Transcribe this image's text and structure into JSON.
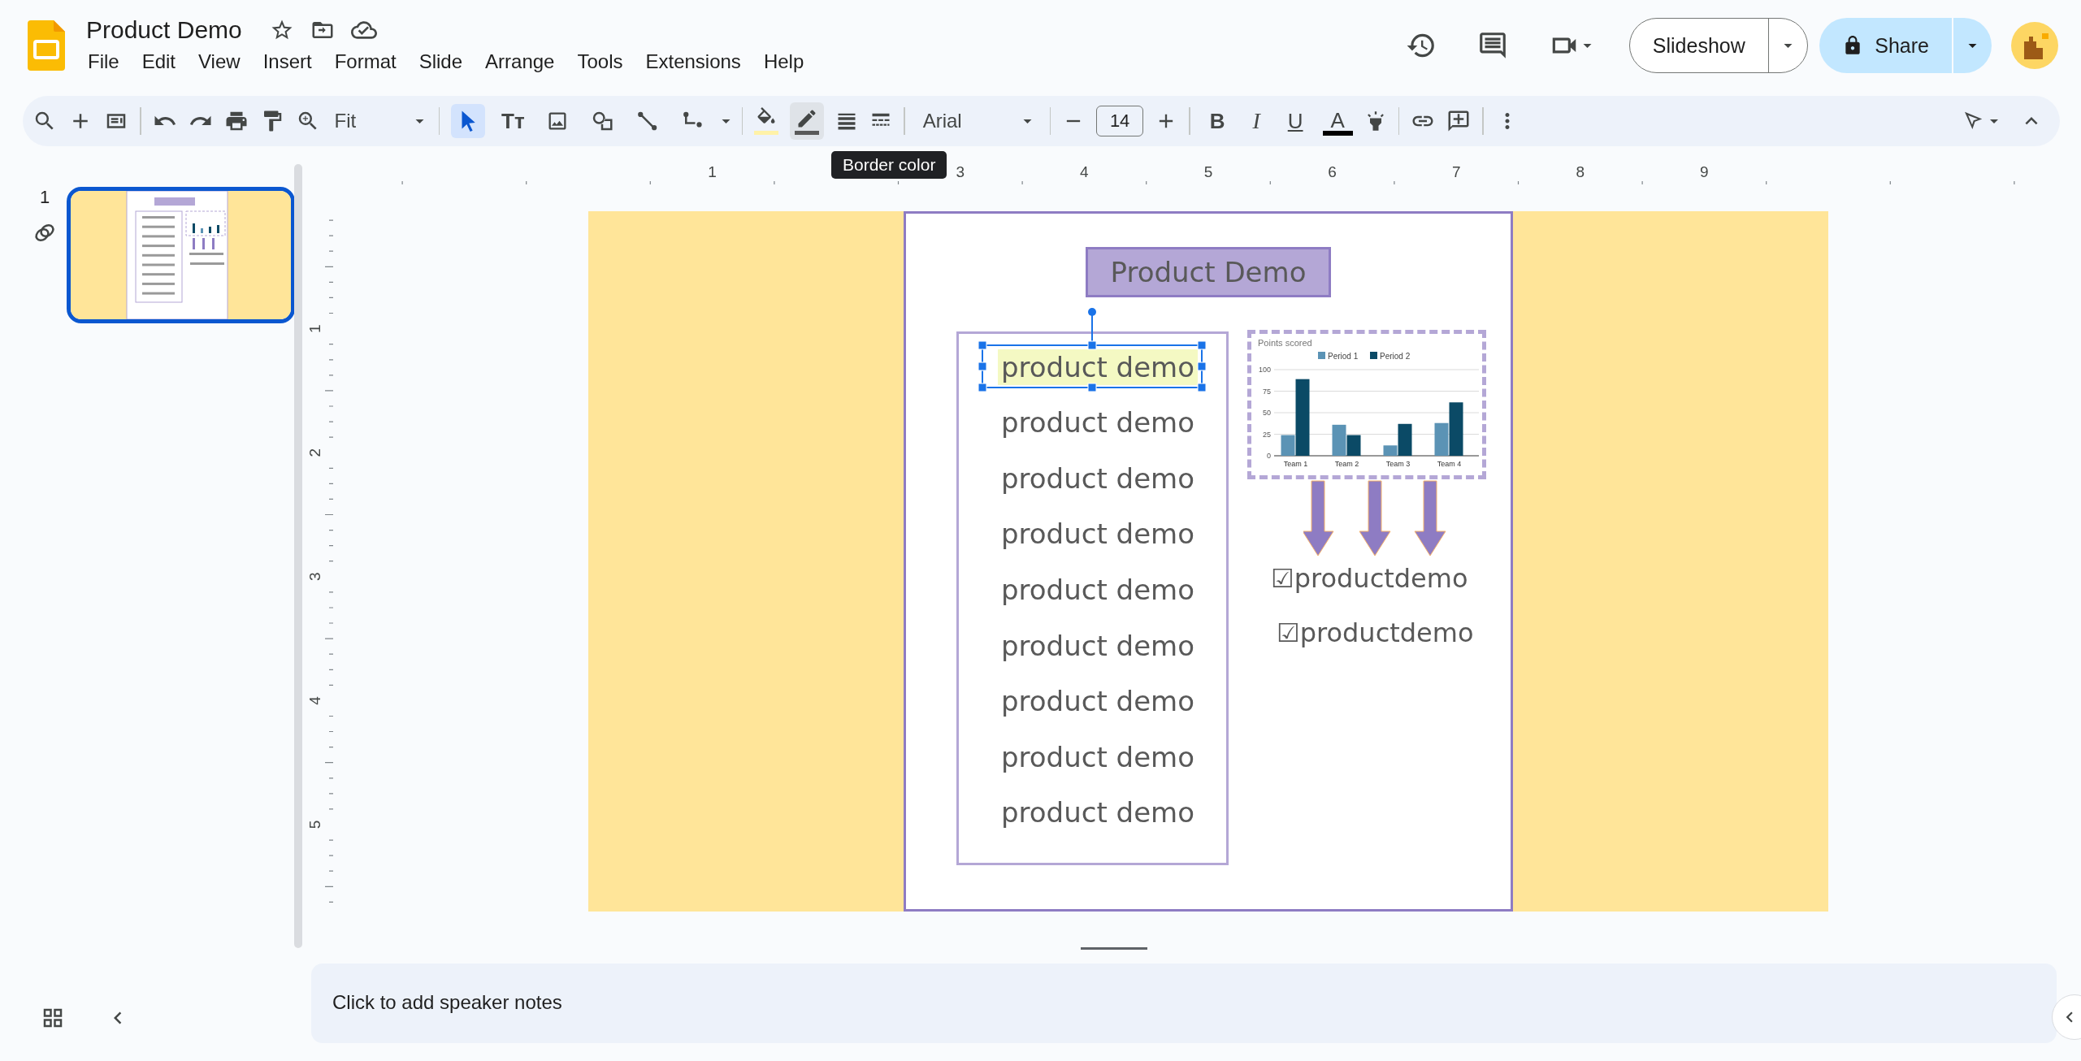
{
  "header": {
    "title": "Product Demo",
    "menu": [
      "File",
      "Edit",
      "View",
      "Insert",
      "Format",
      "Slide",
      "Arrange",
      "Tools",
      "Extensions",
      "Help"
    ],
    "slideshow": "Slideshow",
    "share": "Share"
  },
  "toolbar": {
    "zoom": "Fit",
    "insert_tools": [
      {
        "kind": "select",
        "selected": true
      },
      {
        "kind": "text",
        "label": "Tт",
        "selected": false
      },
      {
        "kind": "image",
        "selected": false
      },
      {
        "kind": "shape",
        "selected": false
      },
      {
        "kind": "line",
        "selected": false
      },
      {
        "kind": "connector",
        "selected": false
      }
    ],
    "border_color": {
      "hovered": true,
      "tooltip": "Border color"
    },
    "font": "Arial",
    "font_size": "14",
    "text_format": [
      {
        "kind": "bold",
        "label": "B"
      },
      {
        "kind": "italic",
        "label": "I"
      },
      {
        "kind": "underline",
        "label": "U"
      },
      {
        "kind": "color",
        "label": "A"
      }
    ]
  },
  "filmstrip": {
    "slides": [
      {
        "number": "1",
        "selected": true
      }
    ]
  },
  "ruler": {
    "horizontal": [
      "1",
      "3",
      "4",
      "5",
      "6",
      "7",
      "8",
      "9"
    ],
    "vertical": [
      "1",
      "2",
      "3",
      "4",
      "5"
    ]
  },
  "slide": {
    "title": "Product Demo",
    "list": [
      {
        "text": "product demo",
        "selected": true
      },
      {
        "text": "product demo",
        "selected": false
      },
      {
        "text": "product demo",
        "selected": false
      },
      {
        "text": "product demo",
        "selected": false
      },
      {
        "text": "product demo",
        "selected": false
      },
      {
        "text": "product demo",
        "selected": false
      },
      {
        "text": "product demo",
        "selected": false
      },
      {
        "text": "product demo",
        "selected": false
      },
      {
        "text": "product demo",
        "selected": false
      }
    ],
    "chart_data": {
      "type": "bar",
      "title": "Points scored",
      "categories": [
        "Team 1",
        "Team 2",
        "Team 3",
        "Team 4"
      ],
      "series": [
        {
          "name": "Period 1",
          "color": "#5b93b5",
          "values": [
            24,
            36,
            12,
            38
          ]
        },
        {
          "name": "Period 2",
          "color": "#0b4a66",
          "values": [
            89,
            24,
            37,
            62
          ]
        }
      ],
      "grid": true,
      "legend": true,
      "ylim": [
        0,
        100
      ],
      "yticks": [
        0,
        {
          "value": 25,
          "label": "25"
        },
        50,
        {
          "value": 75,
          "label": "75"
        },
        100
      ]
    },
    "checklist": [
      "☑productdemo",
      "☑productdemo"
    ]
  },
  "notes": {
    "placeholder": "Click to add speaker notes"
  }
}
